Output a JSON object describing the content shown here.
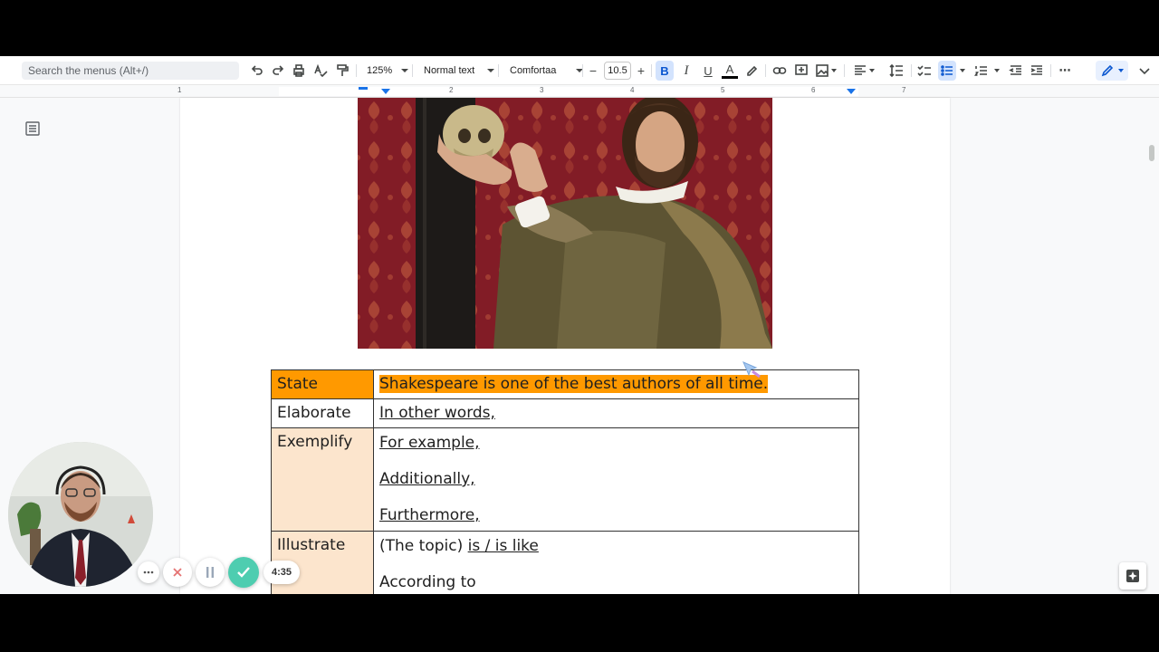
{
  "toolbar": {
    "search_placeholder": "Search the menus (Alt+/)",
    "zoom": "125%",
    "style": "Normal text",
    "font": "Comfortaa",
    "font_size": "10.5",
    "minus": "−",
    "plus": "+",
    "more": "⋯"
  },
  "ruler": {
    "numbers": [
      "1",
      "1",
      "2",
      "3",
      "4",
      "5",
      "6",
      "7"
    ]
  },
  "table": {
    "state": {
      "label": "State",
      "text": "Shakespeare is one of the best authors of all time."
    },
    "elaborate": {
      "label": "Elaborate",
      "text": "In other words,"
    },
    "exemplify": {
      "label": "Exemplify",
      "lines": [
        "For example,",
        "Additionally,",
        "Furthermore,"
      ]
    },
    "illustrate": {
      "label": "Illustrate",
      "line1_prefix": "(The topic) ",
      "line1_link": "is / is like",
      "line2": "According to"
    }
  },
  "recorder": {
    "timer": "4:35"
  },
  "colors": {
    "highlight": "#ff9900",
    "label_fill": "#fce5cd",
    "accent": "#1a73e8",
    "confirm_green": "#4ecdb0",
    "cancel_red": "#e57373"
  }
}
